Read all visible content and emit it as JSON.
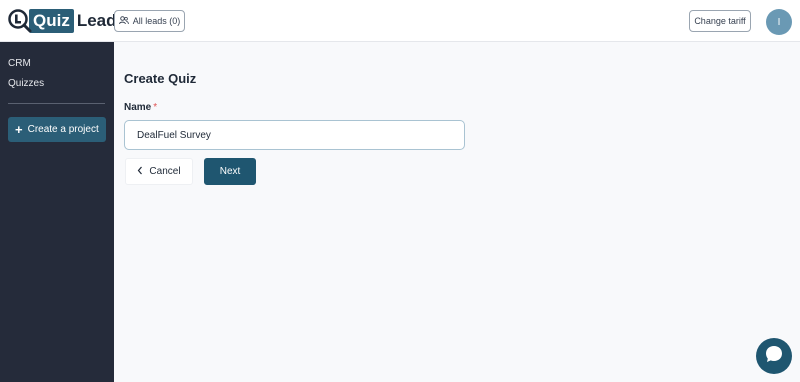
{
  "brand": {
    "logo_part1": "Quiz",
    "logo_part2": "Lead",
    "accent": "#2b5e77",
    "sidebar_bg": "#252b3a"
  },
  "header": {
    "all_leads_label": "All leads (0)",
    "change_tariff_label": "Change tariff",
    "avatar_initial": "I"
  },
  "sidebar": {
    "items": [
      {
        "label": "CRM"
      },
      {
        "label": "Quizzes"
      }
    ],
    "create_project_label": "Create a project"
  },
  "main": {
    "title": "Create Quiz",
    "name_label": "Name",
    "required_mark": "*",
    "name_value": "DealFuel Survey",
    "cancel_label": "Cancel",
    "next_label": "Next"
  },
  "icons": {
    "leads": "users-icon",
    "cancel": "chevron-left-icon",
    "chat": "chat-icon",
    "plus": "plus-icon"
  }
}
